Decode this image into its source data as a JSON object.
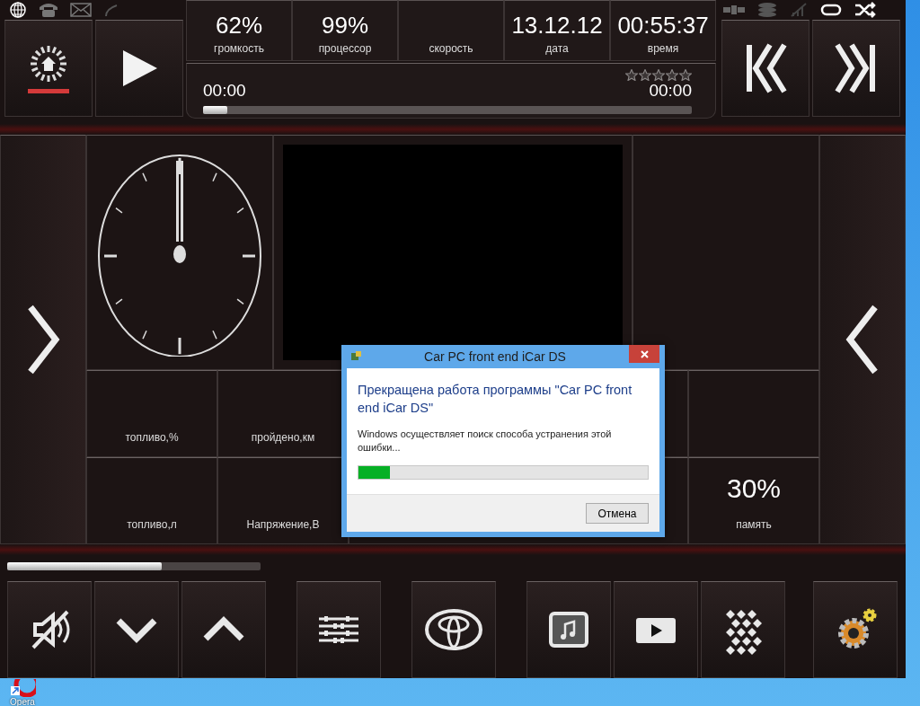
{
  "info_cells": [
    {
      "value": "62%",
      "label": "громкость"
    },
    {
      "value": "99%",
      "label": "процессор"
    },
    {
      "label": "скорость"
    },
    {
      "value": "13.12.12",
      "label": "дата"
    },
    {
      "value": "00:55:37",
      "label": "время"
    }
  ],
  "player": {
    "elapsed": "00:00",
    "stars": 0,
    "duration": "00:00",
    "level": 0.05
  },
  "home_button": {
    "active": true
  },
  "tiles": [
    {
      "kind": "gauge",
      "label": "топливо,%"
    },
    {
      "kind": "gauge",
      "label": "пройдено,км"
    },
    {
      "kind": "blank"
    },
    {
      "kind": "blank"
    },
    {
      "kind": "gauge",
      "label": "топливо,л"
    },
    {
      "kind": "gauge",
      "label": "Напряжение,В"
    },
    {
      "kind": "blank"
    },
    {
      "kind": "gauge",
      "value": "30%",
      "label": "память"
    }
  ],
  "volume": {
    "level": 0.61
  },
  "dialog": {
    "title": "Car PC front end iCar DS",
    "heading": "Прекращена работа программы \"Car PC front end iCar DS\"",
    "message": "Windows осуществляет поиск способа устранения этой ошибки...",
    "progress": {
      "level": 0.11
    },
    "buttons": [
      "Отмена"
    ]
  },
  "desktop": {
    "icon_label": "Opera"
  }
}
